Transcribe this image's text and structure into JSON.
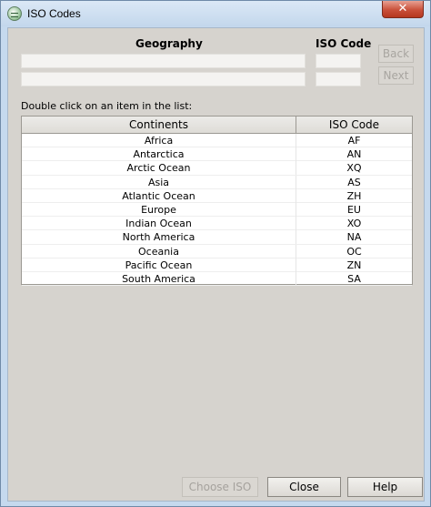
{
  "window": {
    "title": "ISO Codes",
    "close_glyph": "✕"
  },
  "header": {
    "geography_label": "Geography",
    "iso_code_label": "ISO Code"
  },
  "fields": {
    "geography_1": "",
    "geography_2": "",
    "iso_1": "",
    "iso_2": ""
  },
  "nav": {
    "back_label": "Back",
    "next_label": "Next"
  },
  "instruction": "Double click on an item in the list:",
  "table": {
    "columns": [
      "Continents",
      "ISO Code"
    ],
    "rows": [
      {
        "name": "Africa",
        "code": "AF"
      },
      {
        "name": "Antarctica",
        "code": "AN"
      },
      {
        "name": "Arctic Ocean",
        "code": "XQ"
      },
      {
        "name": "Asia",
        "code": "AS"
      },
      {
        "name": "Atlantic Ocean",
        "code": "ZH"
      },
      {
        "name": "Europe",
        "code": "EU"
      },
      {
        "name": "Indian Ocean",
        "code": "XO"
      },
      {
        "name": "North America",
        "code": "NA"
      },
      {
        "name": "Oceania",
        "code": "OC"
      },
      {
        "name": "Pacific Ocean",
        "code": "ZN"
      },
      {
        "name": "South America",
        "code": "SA"
      }
    ]
  },
  "buttons": {
    "choose_iso": "Choose ISO",
    "close": "Close",
    "help": "Help"
  },
  "colors": {
    "titlebar": "#c3d7ec",
    "dialog_background": "#d6d3ce",
    "close_button": "#c9503a"
  }
}
